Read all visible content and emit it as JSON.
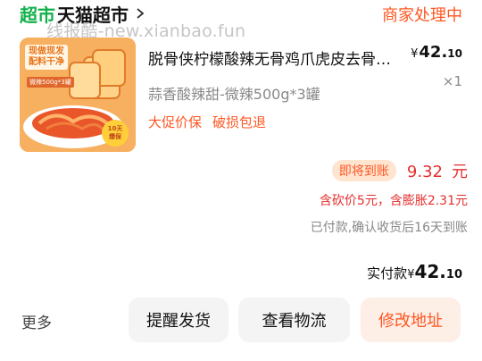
{
  "header": {
    "logo": "超市",
    "shop_name": "天猫超市",
    "status": "商家处理中"
  },
  "watermark": "线报酷-new.xianbao.fun",
  "product": {
    "thumb_tag": "现做现发\n配料干净",
    "thumb_spec": "微辣500g*3罐",
    "thumb_badge": "10天\n爆保",
    "title": "脱骨侠柠檬酸辣无骨鸡爪虎皮去骨凤爪",
    "price_symbol": "¥",
    "price_int": "42.",
    "price_dec": "10",
    "spec": "蒜香酸辣甜-微辣500g*3罐",
    "quantity": "×1",
    "tags": [
      "大促价保",
      "破损包退"
    ]
  },
  "pending": {
    "badge": "即将到账",
    "amount": "9.32",
    "unit": "元"
  },
  "discount_note": "含砍价5元，含膨胀2.31元",
  "paid_note": "已付款,确认收货后16天到账",
  "actual": {
    "label": "实付款",
    "symbol": "¥",
    "int": "42.",
    "dec": "10"
  },
  "actions": {
    "more": "更多",
    "remind": "提醒发货",
    "track": "查看物流",
    "change_address": "修改地址"
  },
  "colors": {
    "brand_green": "#11b14a",
    "accent_orange": "#ff5722",
    "price_red": "#e62d2d"
  }
}
